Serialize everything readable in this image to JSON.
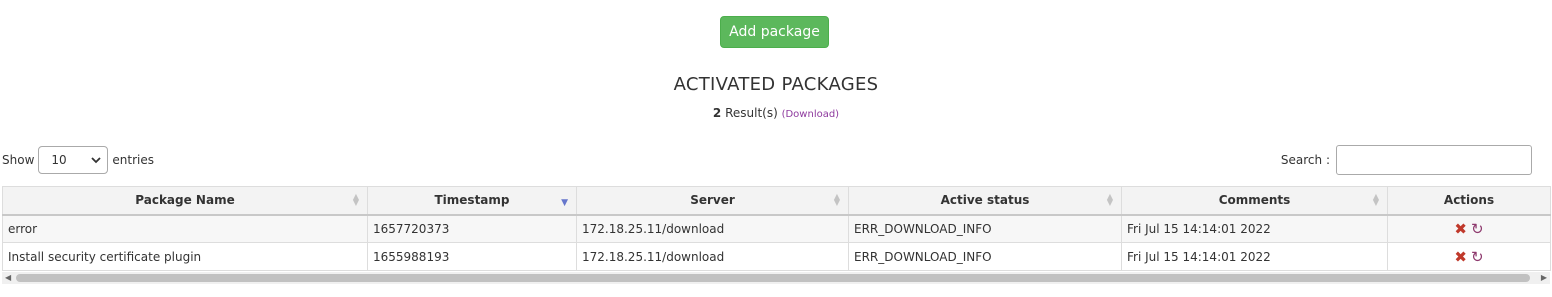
{
  "add_button": "Add package",
  "title": "ACTIVATED PACKAGES",
  "results": {
    "count": "2",
    "suffix": " Result(s) ",
    "download_link": "(Download)"
  },
  "length": {
    "show_label": "Show",
    "value": "10",
    "entries_label": "entries"
  },
  "search": {
    "label": "Search :",
    "value": ""
  },
  "table": {
    "headers": [
      "Package Name",
      "Timestamp",
      "Server",
      "Active status",
      "Comments",
      "Actions"
    ],
    "rows": [
      [
        "error",
        "1657720373",
        "172.18.25.11/download",
        "ERR_DOWNLOAD_INFO",
        "Fri Jul 15 14:14:01 2022"
      ],
      [
        "Install security certificate plugin",
        "1655988193",
        "172.18.25.11/download",
        "ERR_DOWNLOAD_INFO",
        "Fri Jul 15 14:14:01 2022"
      ]
    ]
  },
  "icons": {
    "delete": "delete-icon",
    "retry": "refresh-icon",
    "sort": "sort-icon",
    "sort_desc": "sort-desc-icon"
  },
  "colors": {
    "button": "#5cb85c",
    "link": "#8e3a9e",
    "delete": "#c0392b",
    "retry": "#8e3a6e"
  }
}
